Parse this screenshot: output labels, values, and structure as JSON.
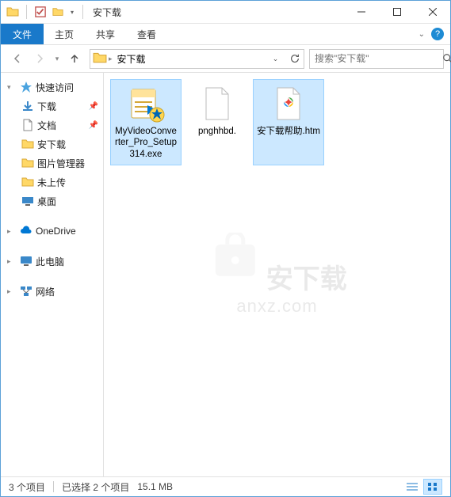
{
  "window": {
    "title": "安下载"
  },
  "ribbon": {
    "file": "文件",
    "tabs": [
      "主页",
      "共享",
      "查看"
    ]
  },
  "address": {
    "path": "安下载"
  },
  "search": {
    "placeholder": "搜索\"安下载\""
  },
  "sidebar": {
    "quick_access": "快速访问",
    "items": [
      {
        "label": "下载",
        "pinned": true
      },
      {
        "label": "文档",
        "pinned": true
      },
      {
        "label": "安下载"
      },
      {
        "label": "图片管理器"
      },
      {
        "label": "未上传"
      },
      {
        "label": "桌面"
      }
    ],
    "onedrive": "OneDrive",
    "this_pc": "此电脑",
    "network": "网络"
  },
  "files": [
    {
      "name": "MyVideoConverter_Pro_Setup314.exe",
      "selected": true,
      "type": "exe"
    },
    {
      "name": "pnghhbd.",
      "selected": false,
      "type": "blank"
    },
    {
      "name": "安下载帮助.htm",
      "selected": true,
      "type": "htm"
    }
  ],
  "status": {
    "count": "3 个项目",
    "selection": "已选择 2 个项目",
    "size": "15.1 MB"
  },
  "watermark": {
    "main": "安下载",
    "sub": "anxz.com"
  }
}
